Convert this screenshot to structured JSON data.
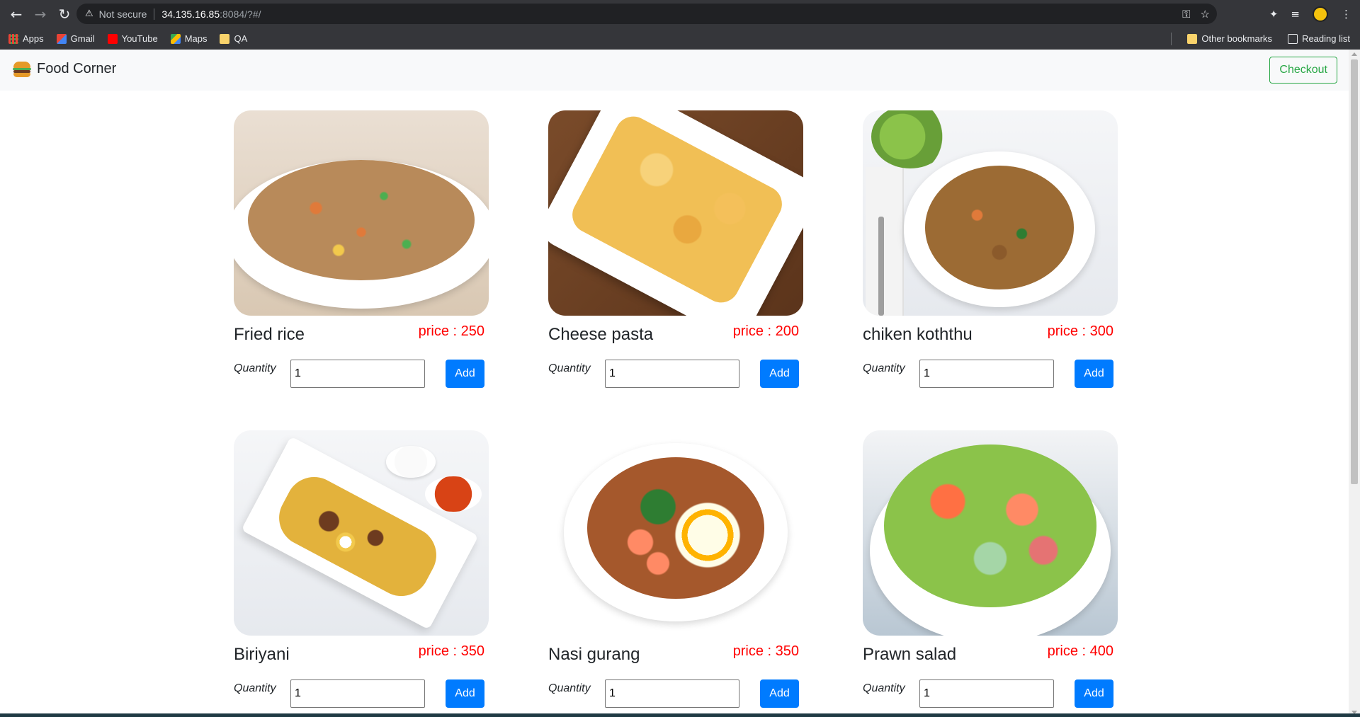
{
  "browser": {
    "security_label": "Not secure",
    "url_host": "34.135.16.85",
    "url_rest": ":8084/?#/",
    "bookmarks": [
      {
        "label": "Apps",
        "icon": "apps-icon"
      },
      {
        "label": "Gmail",
        "icon": "gmail-icon"
      },
      {
        "label": "YouTube",
        "icon": "youtube-icon"
      },
      {
        "label": "Maps",
        "icon": "maps-icon"
      },
      {
        "label": "QA",
        "icon": "folder-icon"
      }
    ],
    "other_bookmarks": "Other bookmarks",
    "reading_list": "Reading list"
  },
  "navbar": {
    "brand": "Food Corner",
    "checkout_label": "Checkout"
  },
  "colors": {
    "checkout": "#28a745",
    "price": "#ff0000",
    "add_button": "#007bff",
    "navbar_bg": "#f8f9fa"
  },
  "products": [
    {
      "name": "Fried rice",
      "price": "price : 250",
      "quantity_label": "Quantity",
      "quantity": "1",
      "add_label": "Add"
    },
    {
      "name": "Cheese pasta",
      "price": "price : 200",
      "quantity_label": "Quantity",
      "quantity": "1",
      "add_label": "Add"
    },
    {
      "name": "chiken koththu",
      "price": "price : 300",
      "quantity_label": "Quantity",
      "quantity": "1",
      "add_label": "Add"
    },
    {
      "name": "Biriyani",
      "price": "price : 350",
      "quantity_label": "Quantity",
      "quantity": "1",
      "add_label": "Add"
    },
    {
      "name": "Nasi gurang",
      "price": "price : 350",
      "quantity_label": "Quantity",
      "quantity": "1",
      "add_label": "Add"
    },
    {
      "name": "Prawn salad",
      "price": "price : 400",
      "quantity_label": "Quantity",
      "quantity": "1",
      "add_label": "Add"
    }
  ]
}
